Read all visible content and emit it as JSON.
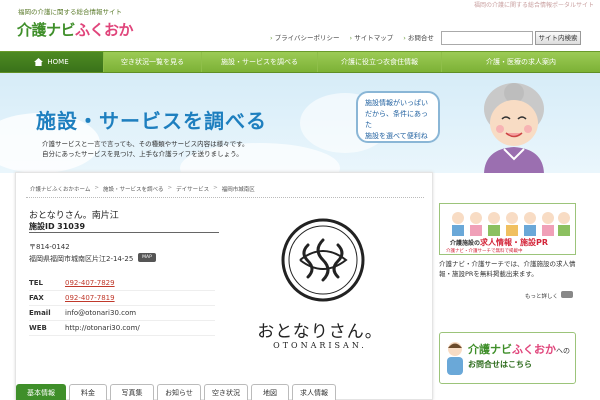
{
  "header": {
    "tagline_left": "福岡の介護に関する総合情報サイト",
    "tagline_right": "福岡の介護に関する総合情報ポータルサイト",
    "logo_main": "介護ナビ",
    "logo_accent": "ふくおか",
    "links": [
      "プライバシーポリシー",
      "サイトマップ",
      "お問合せ"
    ],
    "search_button": "サイト内検索",
    "search_value": ""
  },
  "nav": [
    "HOME",
    "空き状況一覧を見る",
    "施設・サービスを調べる",
    "介護に役立つ衣食住情報",
    "介護・医療の求人案内"
  ],
  "hero": {
    "title": "施設・サービスを調べる",
    "line1": "介護サービスと一言で言っても、その種類やサービス内容は様々です。",
    "line2": "自分にあったサービスを見つけ、上手な介護ライフを送りましょう。",
    "bubble_line1": "施設情報がいっぱい",
    "bubble_line2": "だから、条件にあった",
    "bubble_line3": "施設を選べて便利ね"
  },
  "breadcrumb": [
    "介護ナビふくおかホーム",
    "施設・サービスを調べる",
    "デイサービス",
    "福岡市城南区"
  ],
  "facility": {
    "name": "おとなりさん。南片江",
    "id_label": "施設ID",
    "id_value": "31039",
    "postal": "〒814-0142",
    "address": "福岡県福岡市城南区片江2-14-25",
    "map_button": "MAP",
    "contact": [
      {
        "label": "TEL",
        "value": "092-407-7829"
      },
      {
        "label": "FAX",
        "value": "092-407-7819"
      },
      {
        "label": "Email",
        "value": "info@otonari30.com"
      },
      {
        "label": "WEB",
        "value": "http://otonari30.com/"
      }
    ],
    "logo_text": "おとなりさん。",
    "logo_roman": "OTONARISAN."
  },
  "tabs": [
    "基本情報",
    "料金",
    "写真集",
    "お知らせ",
    "空き状況",
    "地図",
    "求人情報"
  ],
  "sidebar": {
    "ad1_title_a": "介護施設の",
    "ad1_title_b": "求人情報・施設PR",
    "ad1_sub": "介護ナビ・介護サーチで無料で掲載中",
    "ad1_body": "介護ナビ・介護サーチでは、介護施設の求人情報・施設PRを無料掲載出来ます。",
    "more": "もっと詳しく",
    "ad2_title_a": "介護ナビ",
    "ad2_title_b": "ふくおか",
    "ad2_title_c": "への",
    "ad2_sub": "お問合せはこちら"
  },
  "colors": {
    "brand_green": "#3f8f2a",
    "accent_pink": "#e0457b",
    "hero_blue": "#1e7fbf",
    "tel_link": "#c0392b"
  }
}
